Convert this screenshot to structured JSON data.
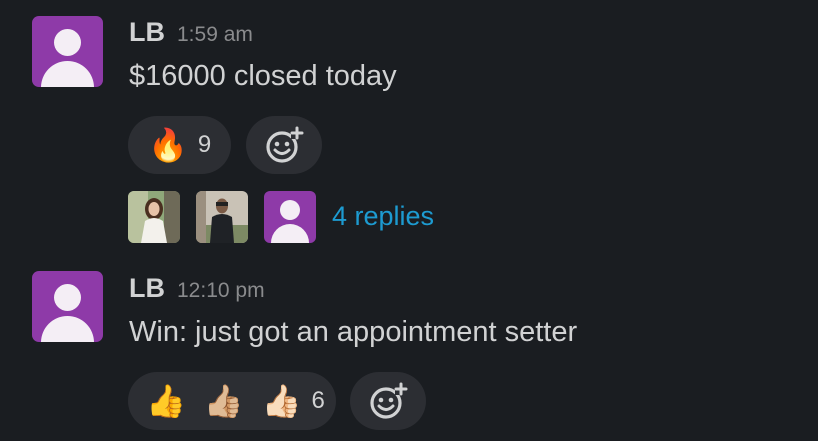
{
  "messages": [
    {
      "author": "LB",
      "time": "1:59 am",
      "text": "$16000 closed today",
      "reactions": [
        {
          "emoji": "🔥",
          "count": "9"
        }
      ],
      "thread": {
        "participants": [
          "woman-in-white-dress",
          "man-in-dark-jacket",
          "default-avatar"
        ],
        "replies_label": "4 replies"
      }
    },
    {
      "author": "LB",
      "time": "12:10 pm",
      "text": "Win: just got an appointment setter",
      "reactions": [
        {
          "emoji": "👍",
          "count": ""
        },
        {
          "emoji": "👍🏼",
          "count": ""
        },
        {
          "emoji": "👍🏻",
          "count": "6"
        }
      ]
    }
  ],
  "colors": {
    "background": "#1a1d21",
    "avatar": "#8e3aa8",
    "reaction_pill": "#2c2e33",
    "link": "#1d9bd1",
    "timestamp": "#8a8b8d"
  }
}
